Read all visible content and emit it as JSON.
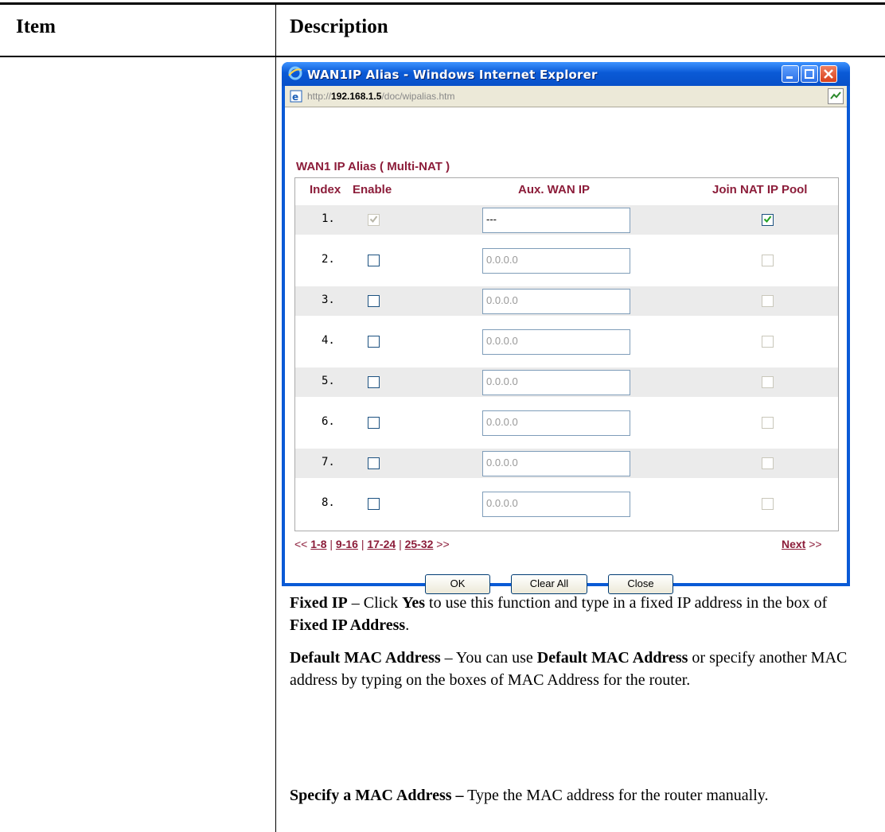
{
  "doc": {
    "col_item": "Item",
    "col_description": "Description"
  },
  "window": {
    "title": "WAN1IP Alias - Windows Internet Explorer",
    "url_prefix": "http://",
    "url_host": "192.168.1.5",
    "url_path": "/doc/wipalias.htm"
  },
  "page": {
    "section_title": "WAN1 IP Alias ( Multi-NAT )",
    "headers": {
      "index": "Index",
      "enable": "Enable",
      "aux_ip": "Aux. WAN IP",
      "join_pool": "Join NAT IP Pool"
    },
    "rows": [
      {
        "index": "1.",
        "enable": true,
        "enable_disabled": true,
        "ip": "---",
        "join": true,
        "join_disabled": false
      },
      {
        "index": "2.",
        "enable": false,
        "enable_disabled": false,
        "ip": "0.0.0.0",
        "join": false,
        "join_disabled": true
      },
      {
        "index": "3.",
        "enable": false,
        "enable_disabled": false,
        "ip": "0.0.0.0",
        "join": false,
        "join_disabled": true
      },
      {
        "index": "4.",
        "enable": false,
        "enable_disabled": false,
        "ip": "0.0.0.0",
        "join": false,
        "join_disabled": true
      },
      {
        "index": "5.",
        "enable": false,
        "enable_disabled": false,
        "ip": "0.0.0.0",
        "join": false,
        "join_disabled": true
      },
      {
        "index": "6.",
        "enable": false,
        "enable_disabled": false,
        "ip": "0.0.0.0",
        "join": false,
        "join_disabled": true
      },
      {
        "index": "7.",
        "enable": false,
        "enable_disabled": false,
        "ip": "0.0.0.0",
        "join": false,
        "join_disabled": true
      },
      {
        "index": "8.",
        "enable": false,
        "enable_disabled": false,
        "ip": "0.0.0.0",
        "join": false,
        "join_disabled": true
      }
    ],
    "pager": {
      "prev": "<<",
      "sep": "|",
      "links": [
        "1-8",
        "9-16",
        "17-24",
        "25-32"
      ],
      "more": ">>",
      "next_label": "Next",
      "next_arrow": ">>"
    },
    "buttons": {
      "ok": "OK",
      "clear_all": "Clear All",
      "close": "Close"
    }
  },
  "description": {
    "fixed_ip": {
      "term": "Fixed IP",
      "t1": " – Click ",
      "b1": "Yes",
      "t2": " to use this function and type in a fixed IP address in the box of ",
      "b2": "Fixed IP Address",
      "t3": "."
    },
    "default_mac": {
      "term": "Default MAC Address",
      "t1": " – You can use ",
      "b1": "Default MAC Address",
      "t2": " or specify another MAC address by typing on the boxes of MAC Address for the router."
    },
    "specify_mac": {
      "term": "Specify a MAC Address –",
      "t1": " Type the MAC address for the router manually."
    }
  },
  "colors": {
    "accent": "#8c1d3a",
    "titlebar": "#0a5ad6"
  }
}
